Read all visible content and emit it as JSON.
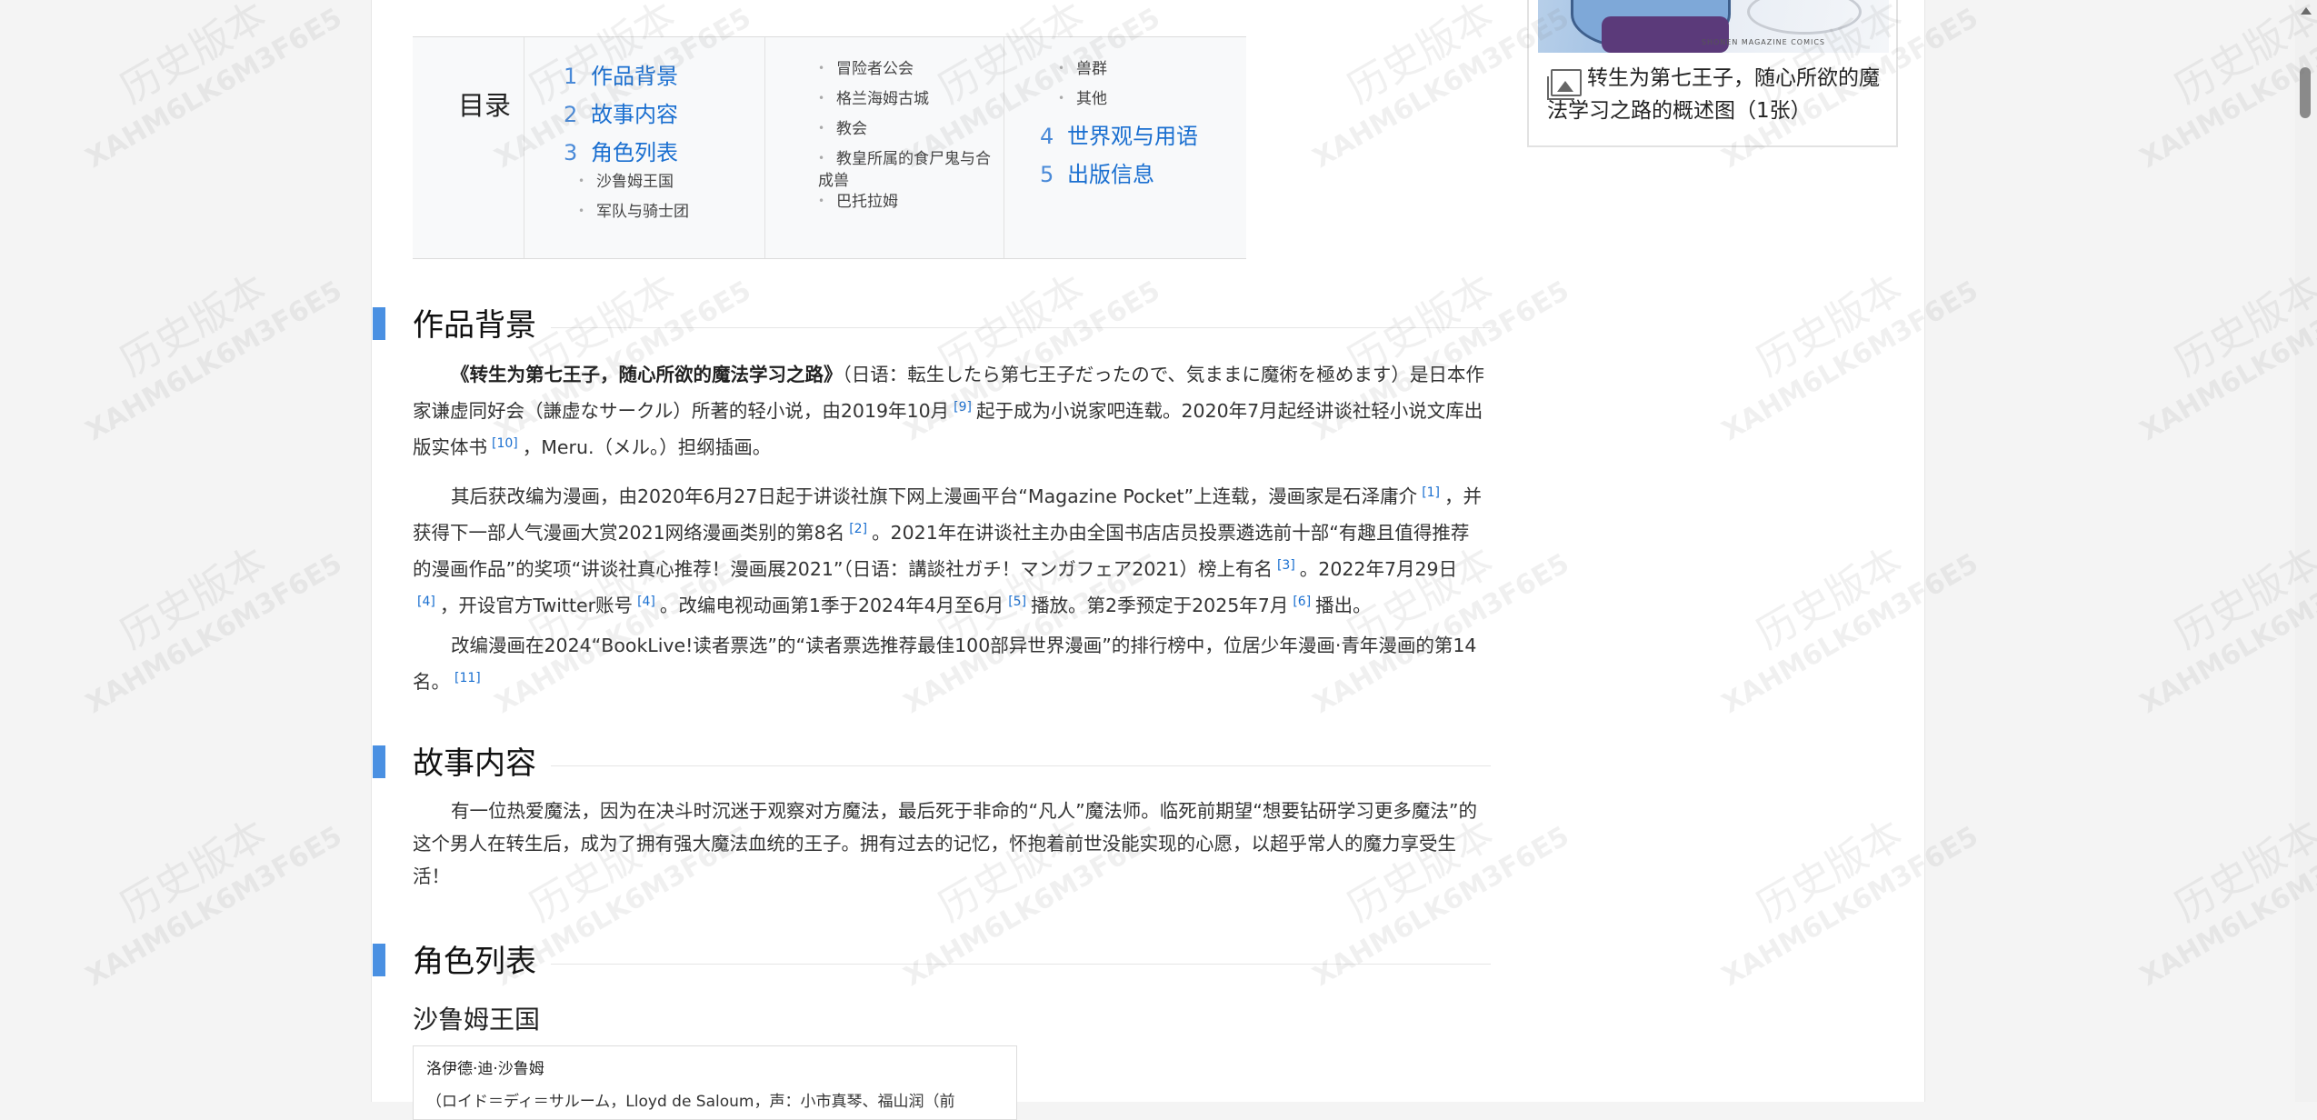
{
  "watermark": {
    "line1": "历史版本",
    "line2": "XAHM6LK6M3F6E5"
  },
  "toc": {
    "title": "目录",
    "col1": [
      {
        "num": "1",
        "label": "作品背景"
      },
      {
        "num": "2",
        "label": "故事内容"
      },
      {
        "num": "3",
        "label": "角色列表"
      }
    ],
    "col1_sub": [
      "沙鲁姆王国",
      "军队与骑士团"
    ],
    "col2_sub": [
      "冒险者公会",
      "格兰海姆古城",
      "教会",
      "教皇所属的食尸鬼与合成兽",
      "巴托拉姆"
    ],
    "col3_sub": [
      "兽群",
      "其他"
    ],
    "col3": [
      {
        "num": "4",
        "label": "世界观与用语"
      },
      {
        "num": "5",
        "label": "出版信息"
      }
    ]
  },
  "sections": {
    "background": {
      "title": "作品背景",
      "p1": {
        "bold": "《转生为第七王子，随心所欲的魔法学习之路》",
        "t1": "（日语：転生したら第七王子だったので、気ままに魔術を極めます）是日本作家谦虚同好会（謙虚なサークル）所著的轻小说，由2019年10月",
        "r1": "[9]",
        "t2": "起于成为小说家吧连载。2020年7月起经讲谈社轻小说文库出版实体书",
        "r2": "[10]",
        "t3": "，Meru.（メル。）担纲插画。"
      },
      "p2": {
        "t1": "其后获改编为漫画，由2020年6月27日起于讲谈社旗下网上漫画平台“Magazine Pocket”上连载，漫画家是石泽庸介",
        "r1": "[1]",
        "t2": "，并获得下一部人气漫画大赏2021网络漫画类别的第8名",
        "r2": "[2]",
        "t3": "。2021年在讲谈社主办由全国书店店员投票遴选前十部“有趣且值得推荐的漫画作品”的奖项“讲谈社真心推荐！漫画展2021”（日语：講談社ガチ！マンガフェア2021）榜上有名",
        "r3": "[3]",
        "t4": "。2022年7月29日",
        "r4": "[4]",
        "t5": "，开设官方Twitter账号",
        "r5": "[4]",
        "t6": "。改编电视动画第1季于2024年4月至6月",
        "r6": "[5]",
        "t7": "播放。第2季预定于2025年7月",
        "r7": "[6]",
        "t8": "播出。"
      },
      "p3": {
        "t1": "改编漫画在2024“BookLive!读者票选”的“读者票选推荐最佳100部异世界漫画”的排行榜中，位居少年漫画·青年漫画的第14名。",
        "r1": "[11]"
      }
    },
    "story": {
      "title": "故事内容",
      "p1": "有一位热爱魔法，因为在决斗时沉迷于观察对方魔法，最后死于非命的“凡人”魔法师。临死前期望“想要钻研学习更多魔法”的这个男人在转生后，成为了拥有强大魔法血统的王子。拥有过去的记忆，怀抱着前世没能实现的心愿，以超乎常人的魔力享受生活！"
    },
    "characters": {
      "title": "角色列表",
      "subsection": "沙鲁姆王国",
      "card_name": "洛伊德·迪·沙鲁姆",
      "card_detail": "（ロイド＝ディ＝サルーム，Lloyd de Saloum，声：小市真琴、福山润（前"
    }
  },
  "sidebar": {
    "image_text": "SHONEN MAGAZINE COMICS",
    "caption": "转生为第七王子，随心所欲的魔法学习之路的概述图（1张）"
  }
}
